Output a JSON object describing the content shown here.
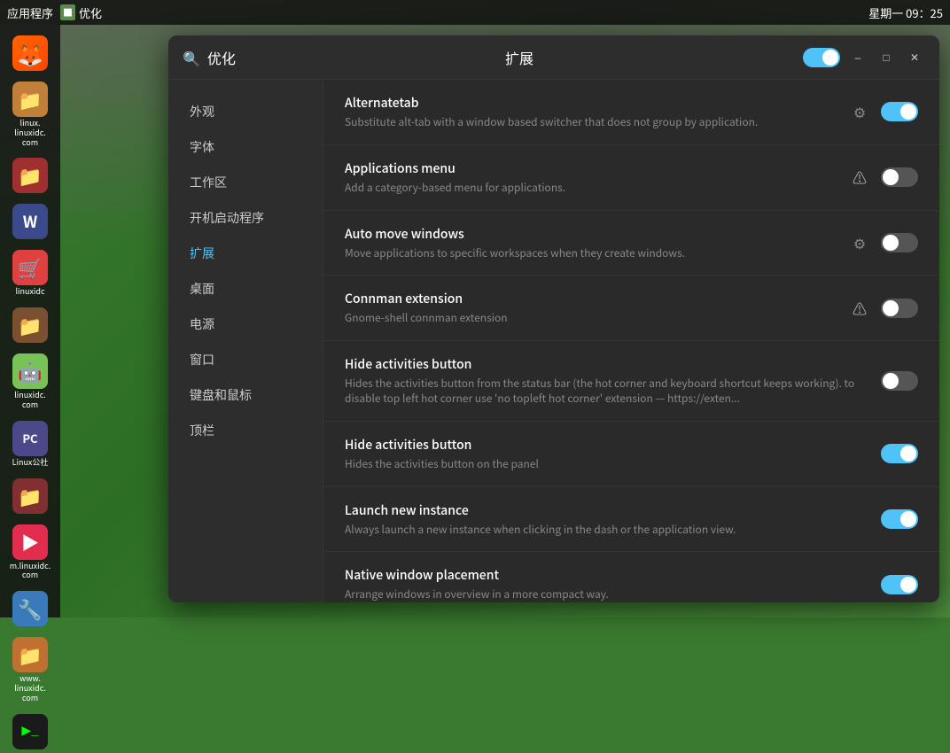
{
  "desktop": {
    "topbar": {
      "apps_label": "应用程序",
      "optimize_icon": "■",
      "optimize_label": "优化",
      "datetime": "星期一 09：25"
    }
  },
  "dock": {
    "items": [
      {
        "id": "firefox",
        "label": "",
        "icon_class": "icon-firefox",
        "icon_text": "🦊"
      },
      {
        "id": "linux-linuxidc",
        "label": "linux.\nlinuxidc.\ncom",
        "icon_class": "icon-folder-orange",
        "icon_text": "📁"
      },
      {
        "id": "folder-red",
        "label": "",
        "icon_class": "icon-folder-red",
        "icon_text": "📁"
      },
      {
        "id": "writer",
        "label": "",
        "icon_class": "icon-writer",
        "icon_text": "W"
      },
      {
        "id": "linuxidc-app",
        "label": "linuxidc",
        "icon_class": "icon-store",
        "icon_text": "🛒"
      },
      {
        "id": "folder-dark",
        "label": "",
        "icon_class": "icon-folder-dark",
        "icon_text": "📁"
      },
      {
        "id": "android",
        "label": "linuxidc.\ncom",
        "icon_class": "icon-android",
        "icon_text": "🤖"
      },
      {
        "id": "pc-app",
        "label": "Linux公社",
        "icon_class": "icon-pc",
        "icon_text": "PC"
      },
      {
        "id": "folder-maroon",
        "label": "",
        "icon_class": "icon-folder-maroon",
        "icon_text": "📁"
      },
      {
        "id": "snap",
        "label": "m.linuxidc.\ncom",
        "icon_class": "icon-snap",
        "icon_text": "▶"
      },
      {
        "id": "linux-tool",
        "label": "",
        "icon_class": "icon-linuxidc",
        "icon_text": "🔧"
      },
      {
        "id": "folder-orange3",
        "label": "www.\nlinuxidc.\ncom",
        "icon_class": "icon-folder-orange3",
        "icon_text": "📁"
      },
      {
        "id": "terminal",
        "label": "",
        "icon_class": "icon-terminal",
        "icon_text": ">_"
      }
    ]
  },
  "window": {
    "title": "优化",
    "center_title": "扩展",
    "toggle_state": "on",
    "minimize_label": "–",
    "restore_label": "□",
    "close_label": "✕",
    "nav": {
      "items": [
        {
          "id": "appearance",
          "label": "外观",
          "active": false
        },
        {
          "id": "fonts",
          "label": "字体",
          "active": false
        },
        {
          "id": "workspaces",
          "label": "工作区",
          "active": false
        },
        {
          "id": "startup",
          "label": "开机启动程序",
          "active": false
        },
        {
          "id": "extensions",
          "label": "扩展",
          "active": true
        },
        {
          "id": "desktop",
          "label": "桌面",
          "active": false
        },
        {
          "id": "power",
          "label": "电源",
          "active": false
        },
        {
          "id": "windows",
          "label": "窗口",
          "active": false
        },
        {
          "id": "keyboard-mouse",
          "label": "键盘和鼠标",
          "active": false
        },
        {
          "id": "topbar",
          "label": "顶栏",
          "active": false
        }
      ]
    },
    "extensions": [
      {
        "id": "alternatetab",
        "title": "Alternatetab",
        "description": "Substitute alt-tab with a window based switcher that does not group by application.",
        "has_gear": true,
        "has_warning": false,
        "toggle": "on"
      },
      {
        "id": "applications-menu",
        "title": "Applications menu",
        "description": "Add a category-based menu for applications.",
        "has_gear": false,
        "has_warning": true,
        "toggle": "off"
      },
      {
        "id": "auto-move-windows",
        "title": "Auto move windows",
        "description": "Move applications to specific workspaces when they create windows.",
        "has_gear": true,
        "has_warning": false,
        "toggle": "off"
      },
      {
        "id": "connman",
        "title": "Connman extension",
        "description": "Gnome-shell connman extension",
        "has_gear": false,
        "has_warning": true,
        "toggle": "off"
      },
      {
        "id": "hide-activities-1",
        "title": "Hide activities button",
        "description": "Hides the activities button from the status bar (the hot corner and keyboard shortcut keeps working). to disable top left hot corner use 'no topleft hot corner' extension — https://exten...",
        "has_gear": false,
        "has_warning": false,
        "toggle": "off"
      },
      {
        "id": "hide-activities-2",
        "title": "Hide activities button",
        "description": "Hides the activities button on the panel",
        "has_gear": false,
        "has_warning": false,
        "toggle": "on"
      },
      {
        "id": "launch-new-instance",
        "title": "Launch new instance",
        "description": "Always launch a new instance when clicking in the dash or the application view.",
        "has_gear": false,
        "has_warning": false,
        "toggle": "on"
      },
      {
        "id": "native-window",
        "title": "Native window placement",
        "description": "Arrange windows in overview in a more compact way.",
        "has_gear": false,
        "has_warning": false,
        "toggle": "on"
      }
    ]
  }
}
